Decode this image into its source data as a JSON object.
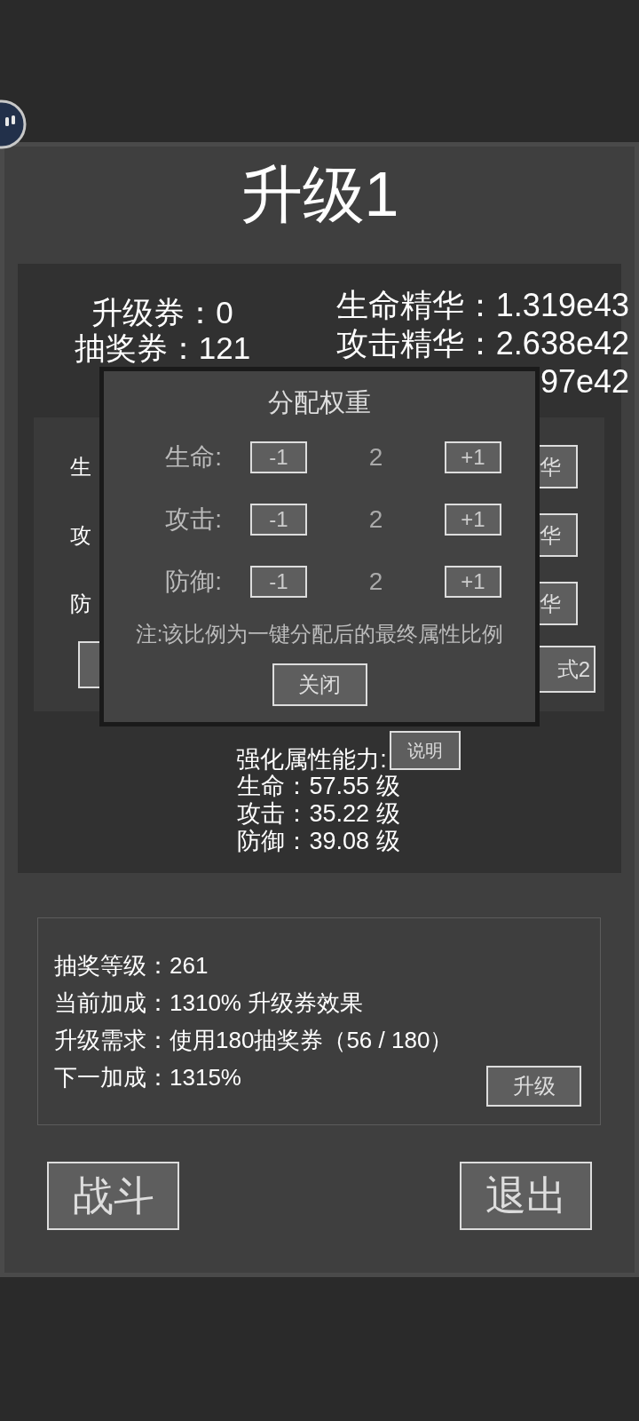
{
  "title": "升级1",
  "tickets": [
    "升级券：0",
    "抽奖券：121"
  ],
  "essences": [
    "生命精华：1.319e43",
    "攻击精华：2.638e42",
    "97e42"
  ],
  "attribute_rows": [
    {
      "label": "生",
      "button": "华"
    },
    {
      "label": "攻",
      "button": "华"
    },
    {
      "label": "防",
      "button": "华"
    }
  ],
  "mode_button": "式2",
  "enhance": {
    "heading": "强化属性能力:",
    "help_button": "说明",
    "lines": [
      "生命：57.55 级",
      "攻击：35.22 级",
      "防御：39.08 级"
    ]
  },
  "lottery": {
    "lines": [
      "抽奖等级：261",
      "当前加成：1310% 升级券效果",
      "升级需求：使用180抽奖券（56 / 180）",
      "下一加成：1315%"
    ],
    "upgrade_button": "升级"
  },
  "actions": [
    "战斗",
    "退出"
  ],
  "dialog": {
    "title": "分配权重",
    "rows": [
      {
        "label": "生命:",
        "decrease": "-1",
        "value": "2",
        "increase": "+1"
      },
      {
        "label": "攻击:",
        "decrease": "-1",
        "value": "2",
        "increase": "+1"
      },
      {
        "label": "防御:",
        "decrease": "-1",
        "value": "2",
        "increase": "+1"
      }
    ],
    "note": "注:该比例为一键分配后的最终属性比例",
    "close_button": "关闭"
  }
}
